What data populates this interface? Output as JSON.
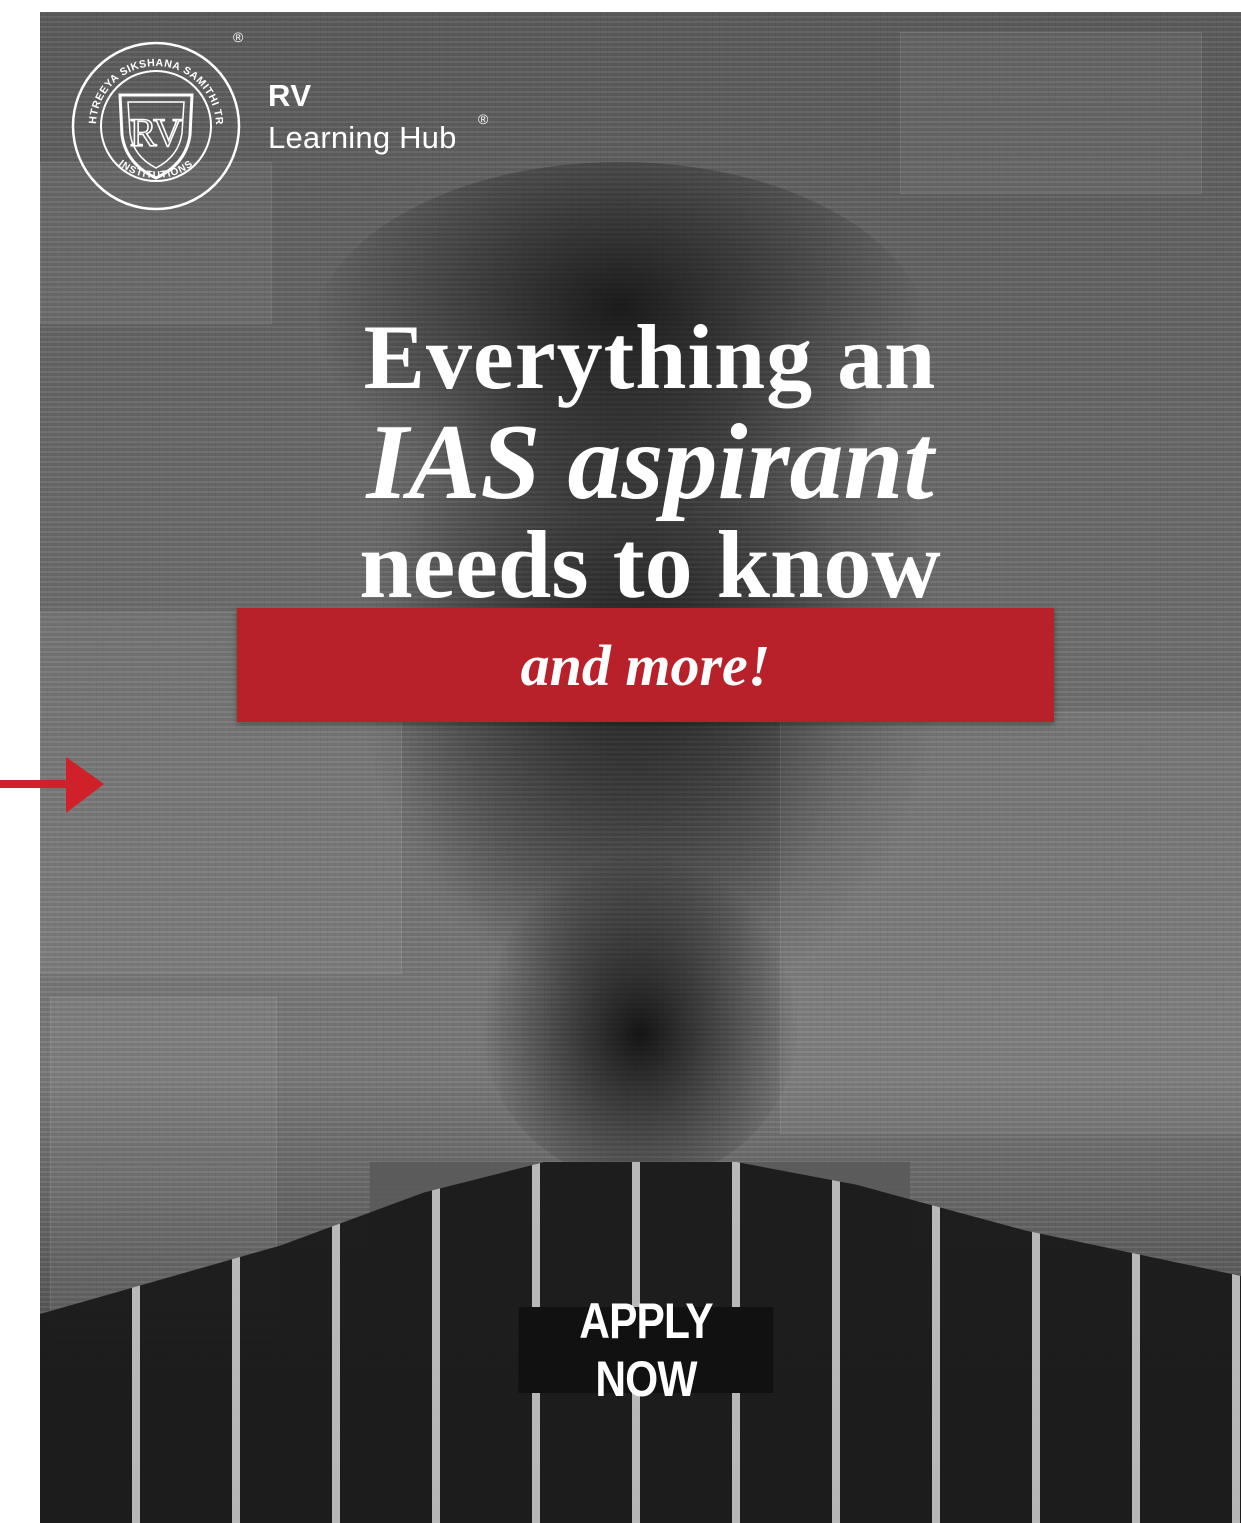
{
  "logo": {
    "ring_text_top": "RASHTREEYA SIKSHANA SAMITHI TRUST",
    "ring_text_bottom": "INSTITUTIONS",
    "shield_letters": "RV",
    "registered_mark": "®"
  },
  "brand": {
    "line1": "RV",
    "line2": "Learning Hub",
    "registered_mark": "®"
  },
  "headline": {
    "line1": "Everything an",
    "line2": "IAS aspirant",
    "line3": "needs to know"
  },
  "banner": {
    "text": "and more!"
  },
  "cta": {
    "label": "APPLY NOW"
  },
  "colors": {
    "accent_red": "#b8202a",
    "arrow_red": "#d0202a",
    "cta_background": "#111111"
  },
  "icons": {
    "pointer": "arrow-right-icon"
  }
}
